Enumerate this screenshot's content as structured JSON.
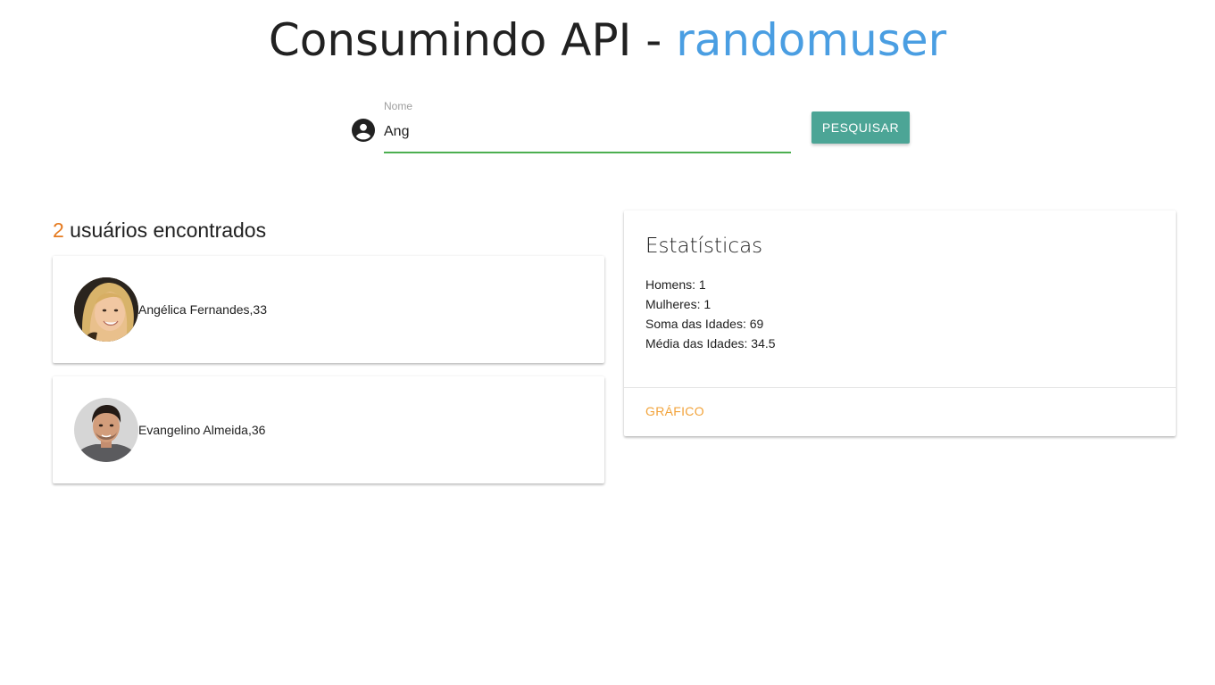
{
  "header": {
    "title_prefix": "Consumindo API - ",
    "title_accent": "randomuser"
  },
  "search": {
    "label": "Nome",
    "value": "Ang",
    "button_label": "PESQUISAR",
    "icon": "account-circle-icon"
  },
  "results": {
    "count": "2",
    "heading_suffix": " usuários encontrados",
    "users": [
      {
        "text": "Angélica Fernandes,33",
        "avatar": "avatar-photo-woman"
      },
      {
        "text": "Evangelino Almeida,36",
        "avatar": "avatar-photo-man"
      }
    ]
  },
  "stats": {
    "title": "Estatísticas",
    "lines": [
      "Homens: 1",
      "Mulheres: 1",
      "Soma das Idades: 69",
      "Média das Idades: 34.5"
    ],
    "action_label": "GRÁFICO"
  },
  "colors": {
    "accent_blue": "#4a9ee2",
    "count_orange": "#e57a1f",
    "button_teal": "#4ca596",
    "input_underline_green": "#4caf50",
    "action_orange": "#f2a33a"
  }
}
